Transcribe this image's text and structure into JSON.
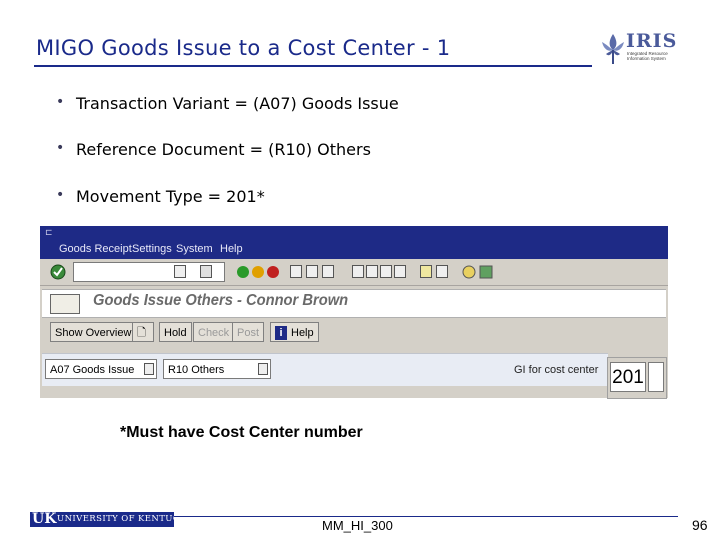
{
  "slide": {
    "title": "MIGO Goods Issue to a Cost Center - 1",
    "bullets": [
      "Transaction Variant = (A07) Goods Issue",
      "Reference Document = (R10) Others",
      "Movement Type = 201*"
    ],
    "note": "*Must have Cost Center number"
  },
  "logo": {
    "word": "IRIS",
    "subtitle": "Integrated Resource Information System"
  },
  "sap": {
    "menu": [
      "Goods Receipt",
      "Settings",
      "System",
      "Help"
    ],
    "window_title": "Goods Issue Others - Connor Brown",
    "buttons": {
      "show_overview": "Show Overview",
      "hold": "Hold",
      "check": "Check",
      "post": "Post",
      "help": "Help"
    },
    "transaction_variant": "A07 Goods Issue",
    "reference_document": "R10 Others",
    "purpose_label": "GI for cost center",
    "movement_type": "201"
  },
  "footer": {
    "university": "UNIVERSITY OF KENTUCKY",
    "uk_mark": "UK",
    "course": "MM_HI_300",
    "page": "96"
  },
  "colors": {
    "title": "#1a2a8a",
    "sap_menubar": "#1e2a86",
    "sap_gray": "#d4d0c8"
  }
}
